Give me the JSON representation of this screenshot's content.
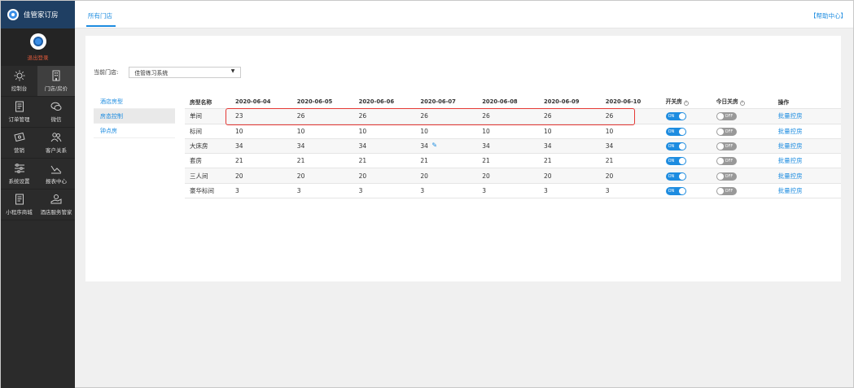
{
  "brand": {
    "name": "佳管家订房"
  },
  "user": {
    "logout_label": "退出登录"
  },
  "sidebar": {
    "items": [
      {
        "label": "控制台",
        "icon": "sun-icon"
      },
      {
        "label": "门店/房价",
        "icon": "building-icon"
      },
      {
        "label": "订单管理",
        "icon": "document-icon"
      },
      {
        "label": "微信",
        "icon": "chat-icon"
      },
      {
        "label": "营销",
        "icon": "ticket-icon"
      },
      {
        "label": "客户关系",
        "icon": "users-icon"
      },
      {
        "label": "系统设置",
        "icon": "sliders-icon"
      },
      {
        "label": "报表中心",
        "icon": "chart-icon"
      },
      {
        "label": "小程序商城",
        "icon": "document-icon"
      },
      {
        "label": "酒店服务管家",
        "icon": "service-icon"
      }
    ]
  },
  "topbar": {
    "tab_label": "所有门店",
    "help_label": "【帮助中心】"
  },
  "store": {
    "label": "当前门店:",
    "value": "佳管练习系统"
  },
  "subnav": {
    "items": [
      "酒店房型",
      "房态控制",
      "钟点房"
    ]
  },
  "table": {
    "headers": {
      "name": "房型名称",
      "dates": [
        "2020-06-04",
        "2020-06-05",
        "2020-06-06",
        "2020-06-07",
        "2020-06-08",
        "2020-06-09",
        "2020-06-10"
      ],
      "open": "开关房",
      "today": "今日关房",
      "op": "操作"
    },
    "rows": [
      {
        "name": "单间",
        "values": [
          "23",
          "26",
          "26",
          "26",
          "26",
          "26",
          "26"
        ],
        "open": "ON",
        "today": "OFF",
        "op": "批量控房"
      },
      {
        "name": "标间",
        "values": [
          "10",
          "10",
          "10",
          "10",
          "10",
          "10",
          "10"
        ],
        "open": "ON",
        "today": "OFF",
        "op": "批量控房"
      },
      {
        "name": "大床房",
        "values": [
          "34",
          "34",
          "34",
          "34",
          "34",
          "34",
          "34"
        ],
        "open": "ON",
        "today": "OFF",
        "op": "批量控房"
      },
      {
        "name": "套房",
        "values": [
          "21",
          "21",
          "21",
          "21",
          "21",
          "21",
          "21"
        ],
        "open": "ON",
        "today": "OFF",
        "op": "批量控房"
      },
      {
        "name": "三人间",
        "values": [
          "20",
          "20",
          "20",
          "20",
          "20",
          "20",
          "20"
        ],
        "open": "ON",
        "today": "OFF",
        "op": "批量控房"
      },
      {
        "name": "豪华标间",
        "values": [
          "3",
          "3",
          "3",
          "3",
          "3",
          "3",
          "3"
        ],
        "open": "ON",
        "today": "OFF",
        "op": "批量控房"
      }
    ]
  },
  "colors": {
    "accent": "#1d8ce0",
    "highlight": "#e53935",
    "sidebar": "#2b2b2b"
  }
}
